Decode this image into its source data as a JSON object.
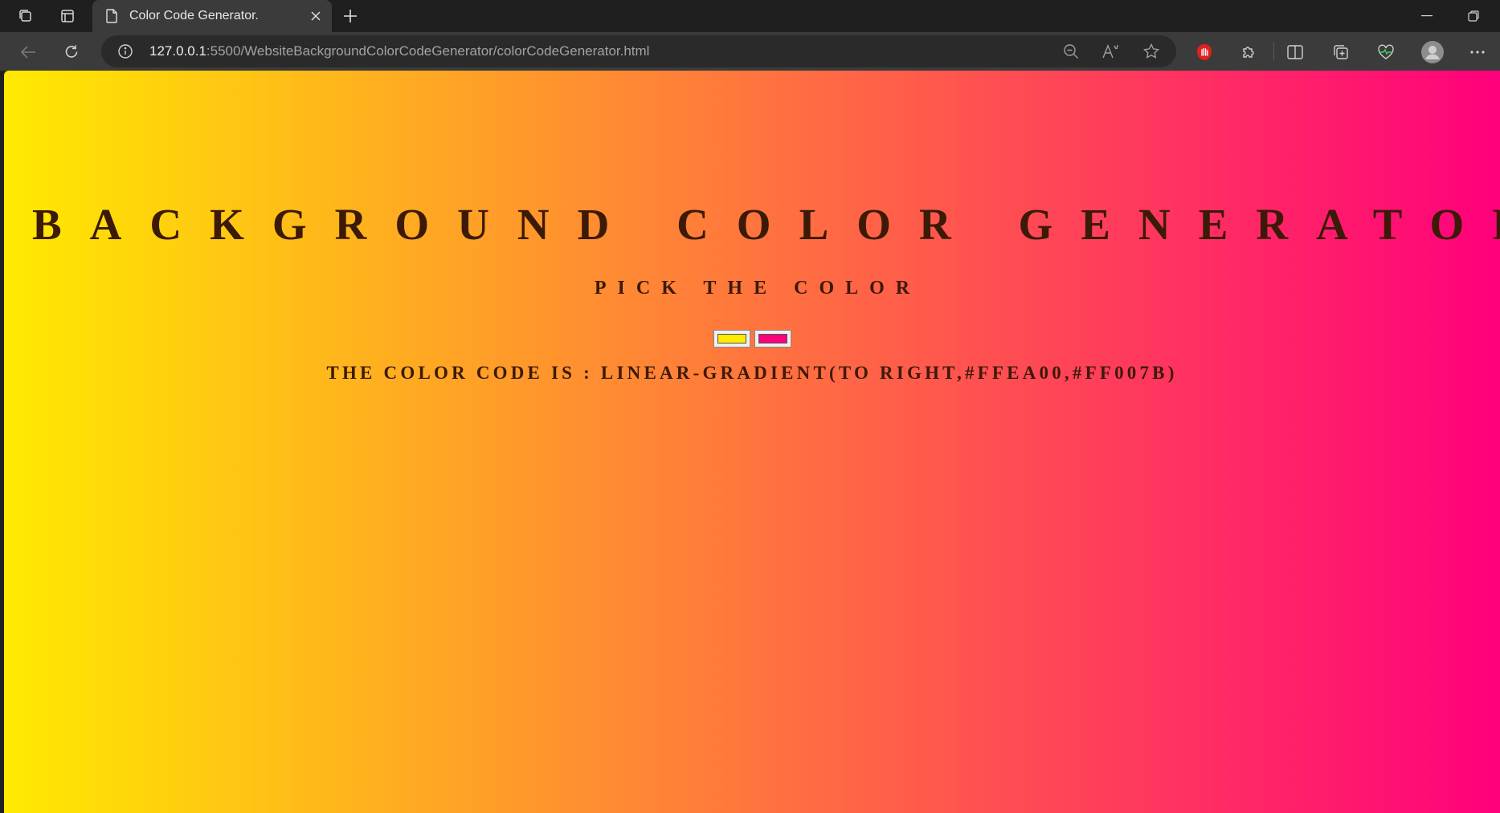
{
  "browser": {
    "tab": {
      "title": "Color Code Generator."
    },
    "url": {
      "host": "127.0.0.1",
      "path": ":5500/WebsiteBackgroundColorCodeGenerator/colorCodeGenerator.html"
    }
  },
  "page": {
    "heading": "BACKGROUND COLOR GENERATOR",
    "subheading": "PICK THE COLOR",
    "color1": "#ffea00",
    "color2": "#ff007b",
    "code_label": "THE COLOR CODE IS : LINEAR-GRADIENT(TO RIGHT,#FFEA00,#FF007B)"
  },
  "icons": {
    "collections": "collections-icon",
    "tab_actions": "tab-actions-icon",
    "page": "page-icon",
    "close": "close-icon",
    "new_tab": "plus-icon",
    "minimize": "minimize-icon",
    "restore": "restore-icon",
    "back": "back-arrow-icon",
    "refresh": "refresh-icon",
    "site_info": "info-icon",
    "zoom": "zoom-out-icon",
    "read_aloud": "read-aloud-icon",
    "favorite": "star-icon",
    "ext_red": "red-hand-extension-icon",
    "extensions": "puzzle-icon",
    "split": "split-screen-icon",
    "collections2": "collections-add-icon",
    "health": "browser-essentials-icon",
    "profile": "profile-avatar-icon",
    "more": "more-icon"
  }
}
